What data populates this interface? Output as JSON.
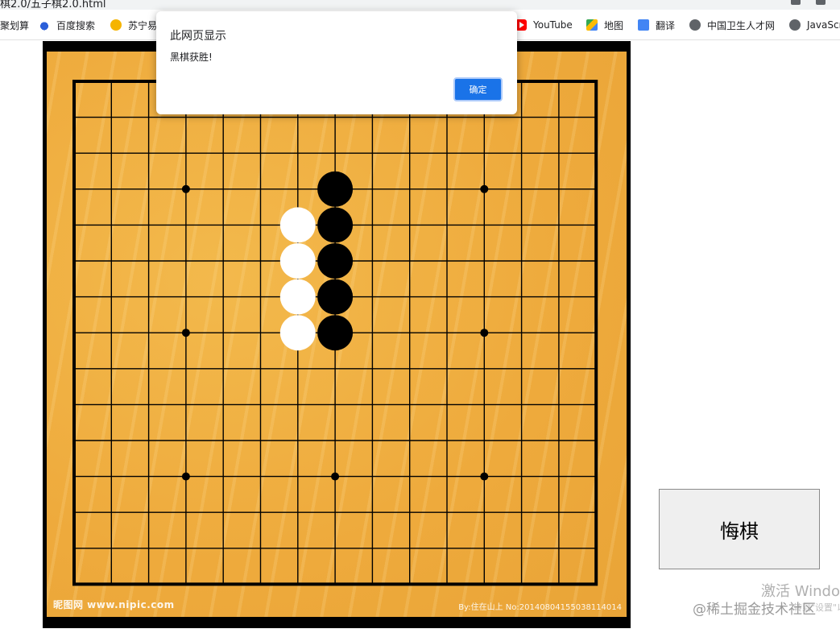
{
  "browser": {
    "url_fragment": "棋2.0/五子棋2.0.html",
    "bookmarks": [
      {
        "label": "聚划算",
        "icon": "none"
      },
      {
        "label": "百度搜索",
        "icon": "baidu-paw-icon"
      },
      {
        "label": "苏宁易",
        "icon": "suning-icon"
      },
      {
        "label": "YouTube",
        "icon": "youtube-icon"
      },
      {
        "label": "地图",
        "icon": "maps-icon"
      },
      {
        "label": "翻译",
        "icon": "translate-icon"
      },
      {
        "label": "中国卫生人才网",
        "icon": "globe-icon"
      },
      {
        "label": "JavaScr",
        "icon": "globe-icon"
      }
    ]
  },
  "dialog": {
    "title": "此网页显示",
    "message": "黑棋获胜!",
    "ok_label": "确定"
  },
  "board": {
    "grid_size": 15,
    "star_points": [
      [
        3,
        3
      ],
      [
        11,
        3
      ],
      [
        3,
        7
      ],
      [
        11,
        7
      ],
      [
        3,
        11
      ],
      [
        7,
        11
      ],
      [
        11,
        11
      ]
    ],
    "stones": {
      "black": [
        [
          7,
          3
        ],
        [
          7,
          4
        ],
        [
          7,
          5
        ],
        [
          7,
          6
        ],
        [
          7,
          7
        ]
      ],
      "white": [
        [
          6,
          4
        ],
        [
          6,
          5
        ],
        [
          6,
          6
        ],
        [
          6,
          7
        ]
      ]
    },
    "watermark_left": "昵图网 www.nipic.com",
    "watermark_right": "By:住在山上 No:20140804155038114014"
  },
  "controls": {
    "undo_label": "悔棋"
  },
  "overlays": {
    "windows_activate": "激活 Windo",
    "windows_activate_sub": "转到\"设置\"以激",
    "juejin_watermark": "@稀土掘金技术社区"
  },
  "colors": {
    "board_wood": "#eeaa3c",
    "dialog_button": "#1a73e8",
    "black_stone": "#000000",
    "white_stone": "#ffffff"
  }
}
